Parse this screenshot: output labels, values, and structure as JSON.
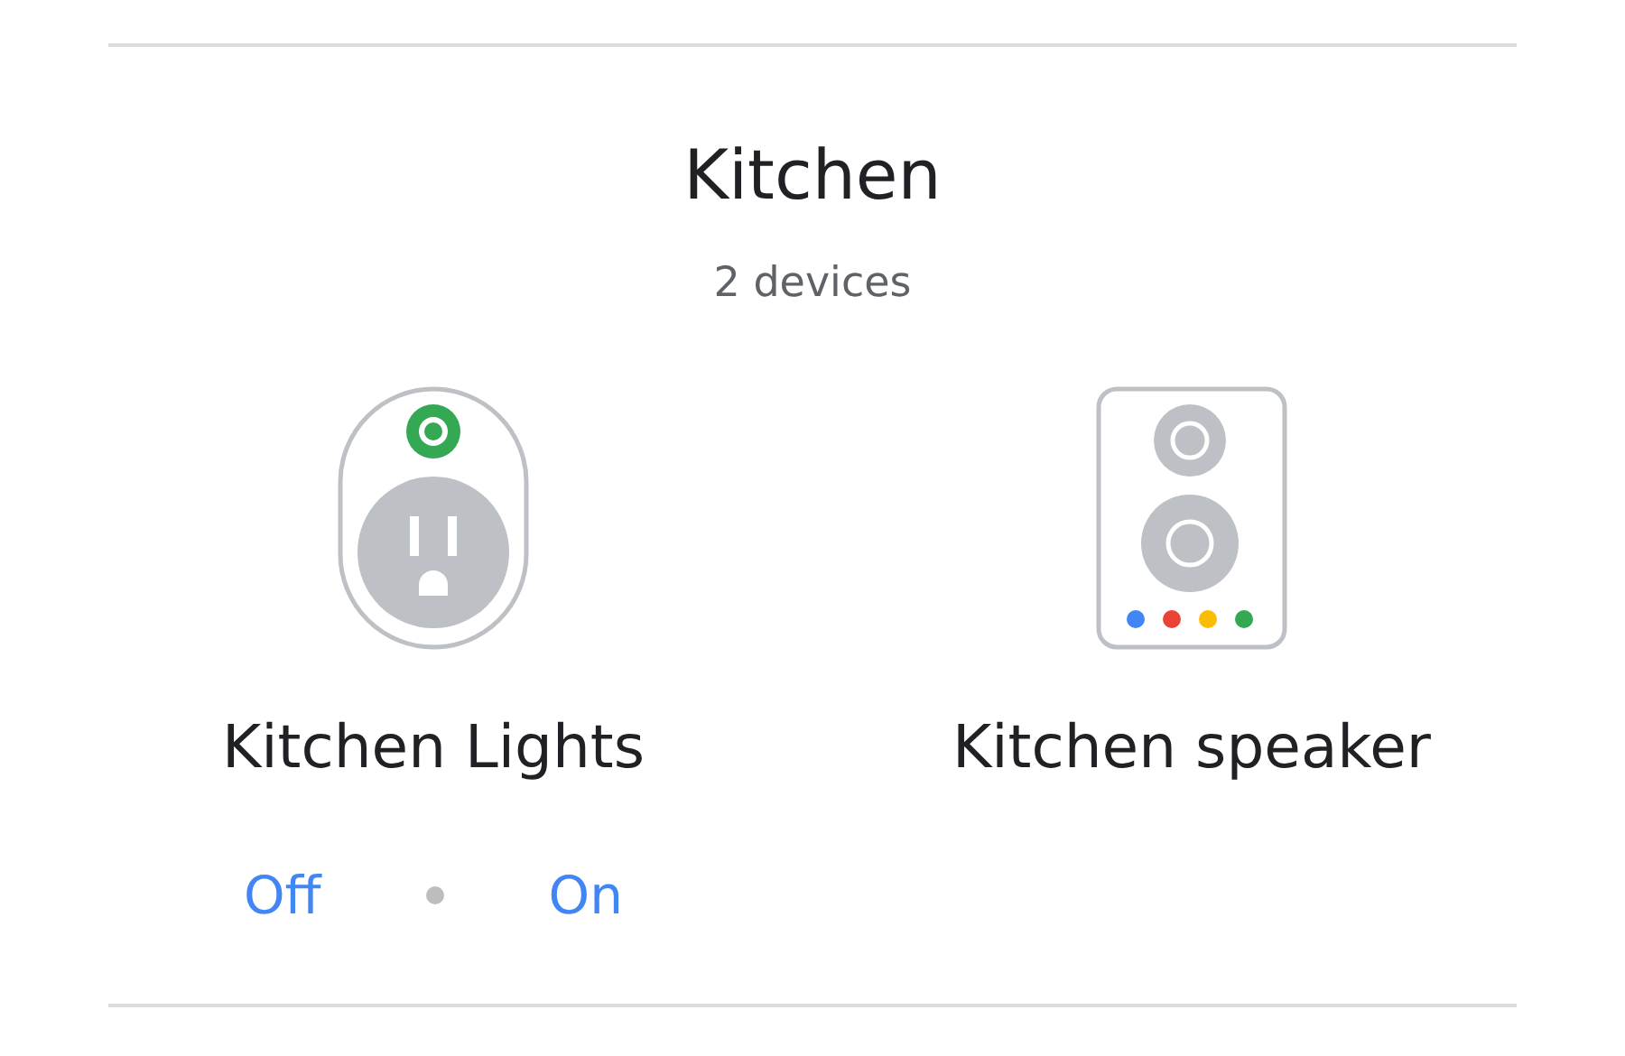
{
  "room": {
    "title": "Kitchen",
    "subtitle": "2 devices"
  },
  "devices": [
    {
      "kind": "plug",
      "name": "Kitchen Lights",
      "actions": [
        "Off",
        "On"
      ]
    },
    {
      "kind": "speaker",
      "name": "Kitchen speaker"
    }
  ]
}
